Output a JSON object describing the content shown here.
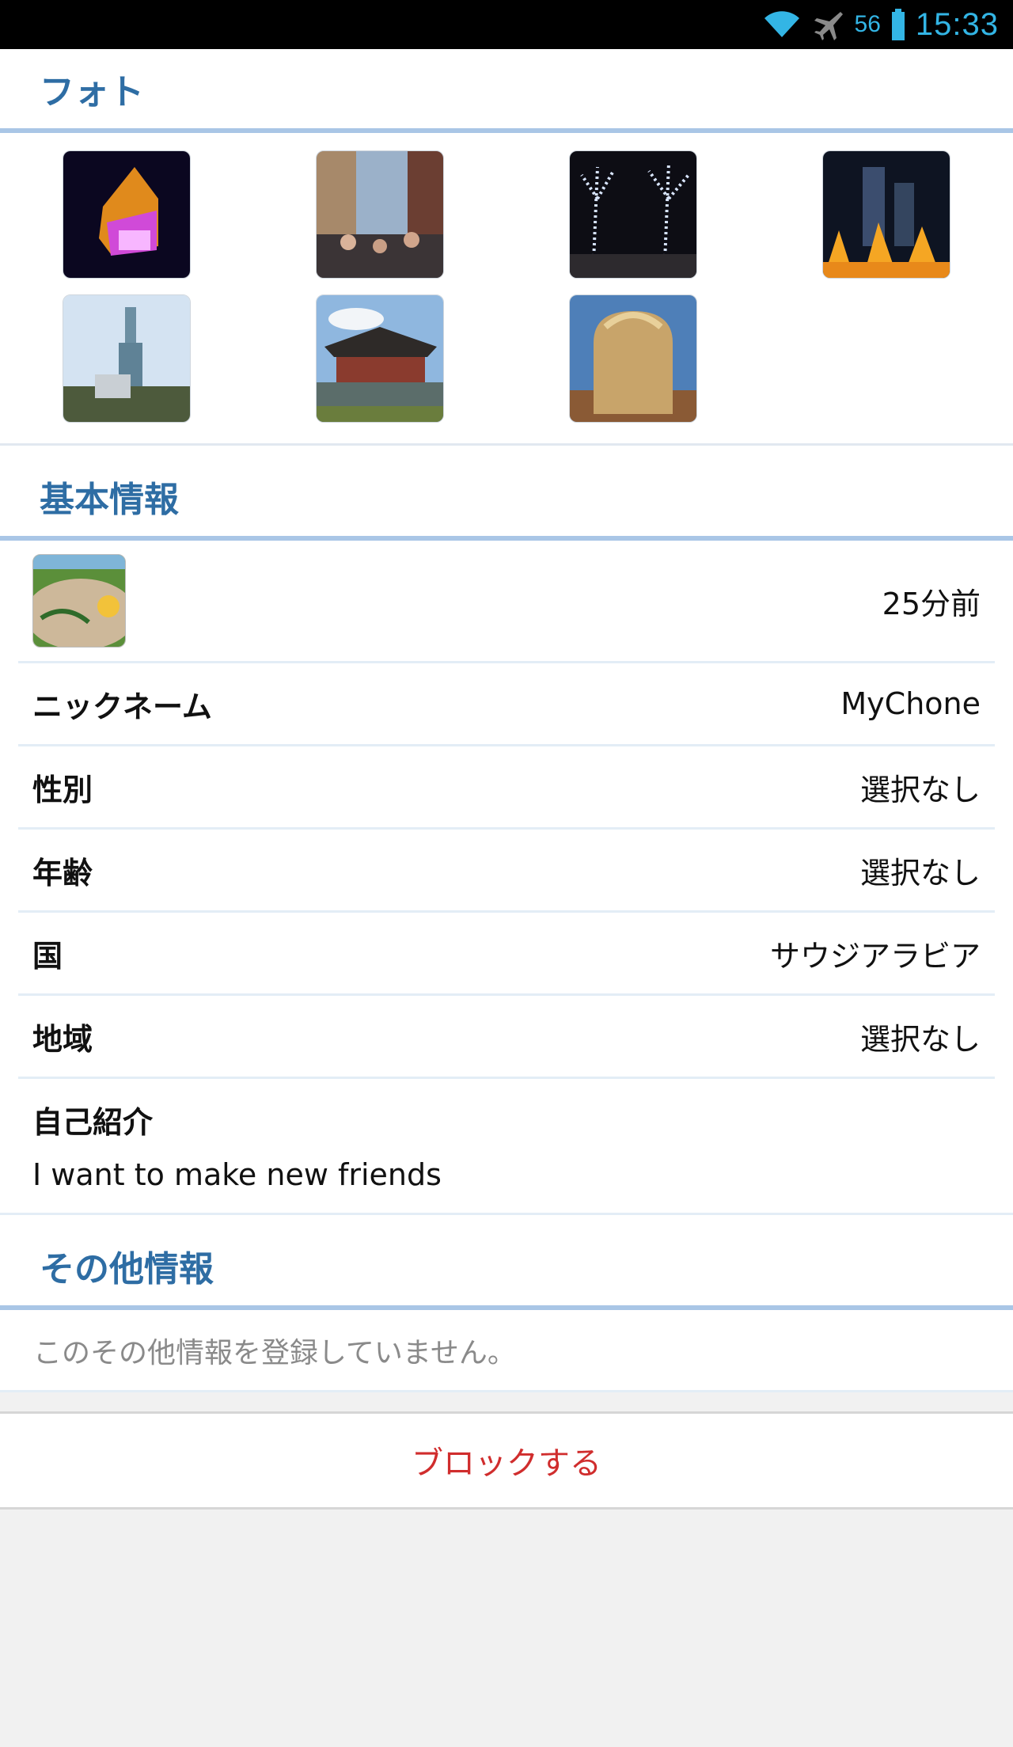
{
  "status_bar": {
    "battery_percent": "56",
    "time": "15:33",
    "accent_color": "#33b5e5",
    "icons": [
      "wifi-icon",
      "airplane-mode-icon",
      "battery-icon"
    ]
  },
  "sections": {
    "photos_title": "フォト",
    "basic_title": "基本情報",
    "other_title": "その他情報"
  },
  "photos": [
    {
      "name": "illuminated-house"
    },
    {
      "name": "street-crowd"
    },
    {
      "name": "light-trees-night"
    },
    {
      "name": "night-fountain-towers"
    },
    {
      "name": "taipei-101"
    },
    {
      "name": "korean-pavilion"
    },
    {
      "name": "bread-loaf"
    }
  ],
  "profile": {
    "last_seen": "25分前",
    "rows": [
      {
        "label": "ニックネーム",
        "value": "MyChone"
      },
      {
        "label": "性別",
        "value": "選択なし"
      },
      {
        "label": "年齢",
        "value": "選択なし"
      },
      {
        "label": "国",
        "value": "サウジアラビア"
      },
      {
        "label": "地域",
        "value": "選択なし"
      }
    ],
    "intro_label": "自己紹介",
    "intro_text": "I want to make new friends"
  },
  "other_info_empty": "このその他情報を登録していません。",
  "block_label": "ブロックする",
  "colors": {
    "section_title": "#2e6da4",
    "section_rule": "#a9c6e6",
    "block_text": "#d02d2d"
  }
}
